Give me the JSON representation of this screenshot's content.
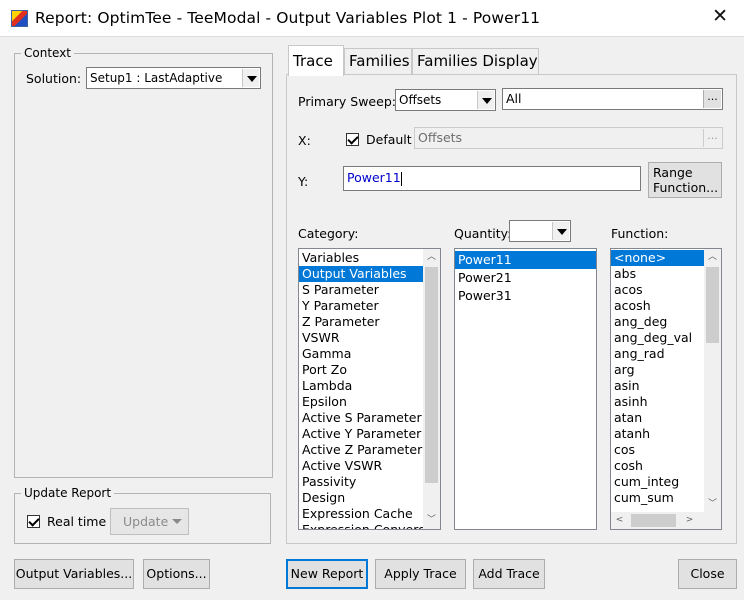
{
  "window": {
    "title": "Report: OptimTee - TeeModal - Output Variables Plot 1 - Power11",
    "close_glyph": "✕"
  },
  "context": {
    "legend": "Context",
    "solution_label": "Solution:",
    "solution_value": "Setup1 : LastAdaptive"
  },
  "update_report": {
    "legend": "Update Report",
    "realtime_label": "Real time",
    "realtime_checked": true,
    "update_label": "Update"
  },
  "tabs": [
    {
      "label": "Trace",
      "active": true
    },
    {
      "label": "Families",
      "active": false
    },
    {
      "label": "Families Display",
      "active": false
    }
  ],
  "trace": {
    "primary_sweep_label": "Primary Sweep:",
    "primary_sweep_value": "Offsets",
    "sweep_range_value": "All",
    "x_label": "X:",
    "default_label": "Default",
    "default_checked": true,
    "x_value": "Offsets",
    "y_label": "Y:",
    "y_value": "Power11",
    "range_function_line1": "Range",
    "range_function_line2": "Function...",
    "category_label": "Category:",
    "quantity_label": "Quantity:",
    "quantity_filter_value": "",
    "function_label": "Function:",
    "categories": [
      "Variables",
      "Output Variables",
      "S Parameter",
      "Y Parameter",
      "Z Parameter",
      "VSWR",
      "Gamma",
      "Port Zo",
      "Lambda",
      "Epsilon",
      "Active S Parameter",
      "Active Y Parameter",
      "Active Z Parameter",
      "Active VSWR",
      "Passivity",
      "Design",
      "Expression Cache",
      "Expression Converge"
    ],
    "categories_selected": 1,
    "quantities": [
      "Power11",
      "Power21",
      "Power31"
    ],
    "quantities_selected": 0,
    "functions": [
      "<none>",
      "abs",
      "acos",
      "acosh",
      "ang_deg",
      "ang_deg_val",
      "ang_rad",
      "arg",
      "asin",
      "asinh",
      "atan",
      "atanh",
      "cos",
      "cosh",
      "cum_integ",
      "cum_sum"
    ],
    "functions_selected": 0,
    "ellipsis": "..."
  },
  "buttons": {
    "output_variables": "Output Variables...",
    "options": "Options...",
    "new_report": "New Report",
    "apply_trace": "Apply Trace",
    "add_trace": "Add Trace",
    "close": "Close"
  },
  "colors": {
    "selection": "#0078d7",
    "focus": "#0078d7",
    "y_text": "#0000cc"
  }
}
